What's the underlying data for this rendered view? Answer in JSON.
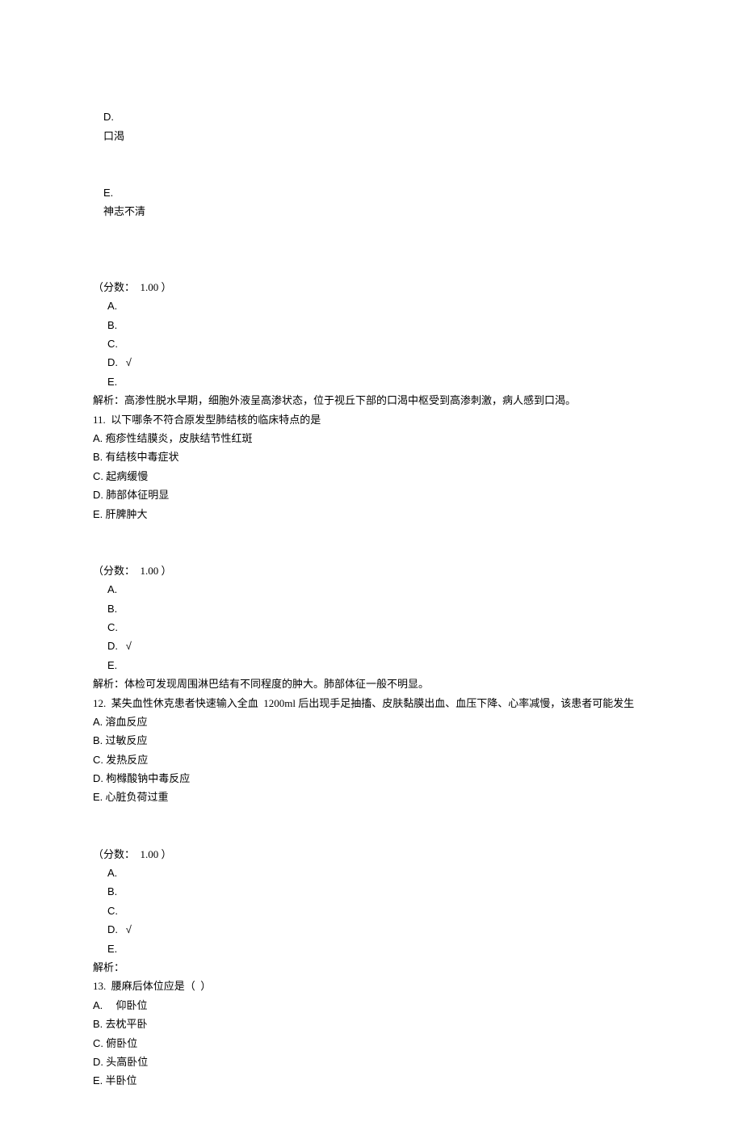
{
  "q10_tail": {
    "options": [
      {
        "letter": "D.",
        "text": "口渴"
      },
      {
        "letter": "E.",
        "text": "神志不清"
      }
    ],
    "score_label": "（分数：  1.00 ）",
    "answers": [
      {
        "letter": "A.",
        "mark": ""
      },
      {
        "letter": "B.",
        "mark": ""
      },
      {
        "letter": "C.",
        "mark": ""
      },
      {
        "letter": "D.",
        "mark": "√"
      },
      {
        "letter": "E.",
        "mark": ""
      }
    ],
    "explanation": "解析：高渗性脱水早期，细胞外液呈高渗状态，位于视丘下部的口渴中枢受到高渗刺激，病人感到口渴。"
  },
  "q11": {
    "stem": "11.  以下哪条不符合原发型肺结核的临床特点的是",
    "options": [
      {
        "letter": "A.",
        "text": "疱疹性结膜炎，皮肤结节性红斑"
      },
      {
        "letter": "B.",
        "text": "有结核中毒症状"
      },
      {
        "letter": "C.",
        "text": "起病缓慢"
      },
      {
        "letter": "D.",
        "text": "肺部体征明显"
      },
      {
        "letter": "E.",
        "text": "肝脾肿大"
      }
    ],
    "score_label": "（分数：  1.00 ）",
    "answers": [
      {
        "letter": "A.",
        "mark": ""
      },
      {
        "letter": "B.",
        "mark": ""
      },
      {
        "letter": "C.",
        "mark": ""
      },
      {
        "letter": "D.",
        "mark": "√"
      },
      {
        "letter": "E.",
        "mark": ""
      }
    ],
    "explanation": "解析：体检可发现周围淋巴结有不同程度的肿大。肺部体征一般不明显。"
  },
  "q12": {
    "stem": "12.  某失血性休克患者快速输入全血  1200ml 后出现手足抽搐、皮肤黏膜出血、血压下降、心率减慢，该患者可能发生",
    "options": [
      {
        "letter": "A.",
        "text": "溶血反应"
      },
      {
        "letter": "B.",
        "text": "过敏反应"
      },
      {
        "letter": "C.",
        "text": "发热反应"
      },
      {
        "letter": "D.",
        "text": "枸橼酸钠中毒反应"
      },
      {
        "letter": "E.",
        "text": "心脏负荷过重"
      }
    ],
    "score_label": "（分数：  1.00 ）",
    "answers": [
      {
        "letter": "A.",
        "mark": ""
      },
      {
        "letter": "B.",
        "mark": ""
      },
      {
        "letter": "C.",
        "mark": ""
      },
      {
        "letter": "D.",
        "mark": "√"
      },
      {
        "letter": "E.",
        "mark": ""
      }
    ],
    "explanation": "解析："
  },
  "q13": {
    "stem": "13.  腰麻后体位应是（  ）",
    "options": [
      {
        "letter": "A.",
        "text": "    仰卧位"
      },
      {
        "letter": "B.",
        "text": "去枕平卧"
      },
      {
        "letter": "C.",
        "text": "俯卧位"
      },
      {
        "letter": "D.",
        "text": "头高卧位"
      },
      {
        "letter": "E.",
        "text": "半卧位"
      }
    ]
  }
}
